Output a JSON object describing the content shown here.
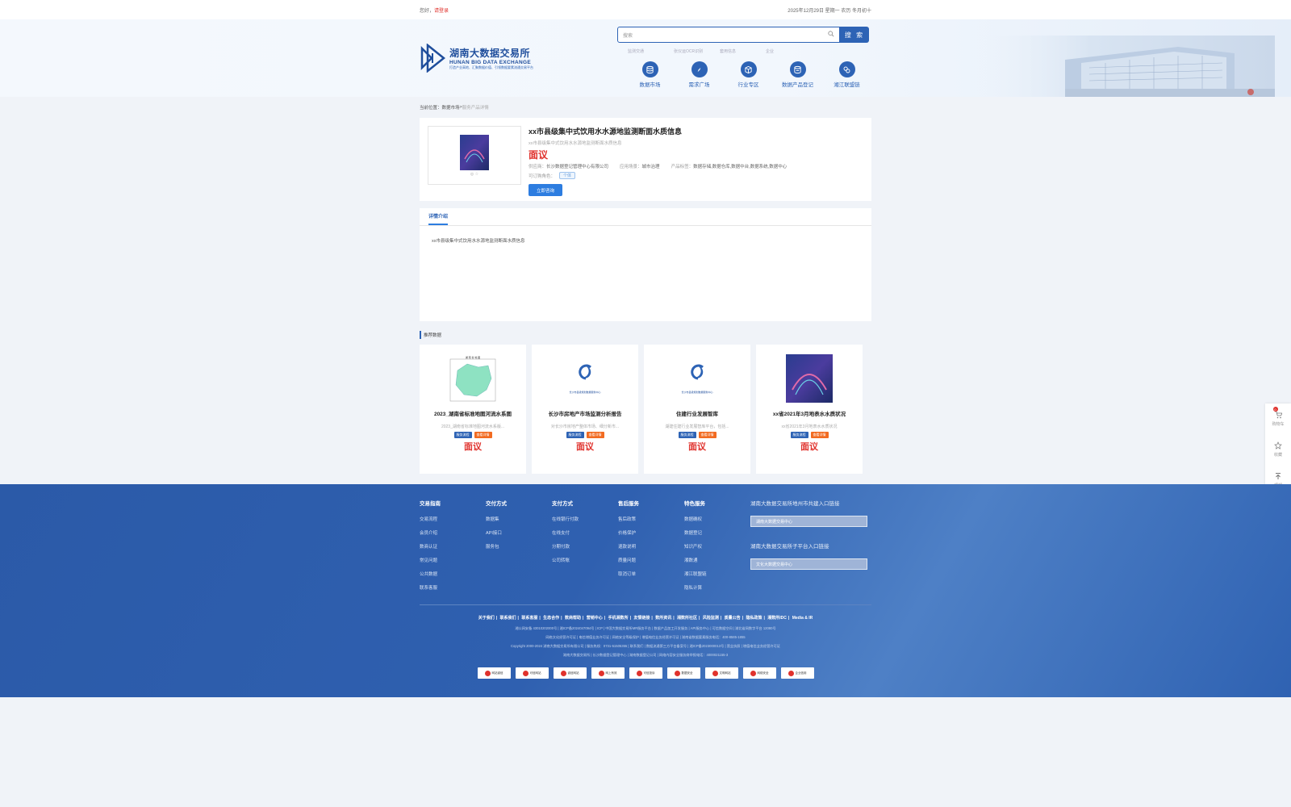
{
  "topbar": {
    "greeting": "您好，",
    "login": "请登录",
    "date": "2025年12月29日 星期一 农历 冬月初十"
  },
  "header": {
    "logo_cn": "湖南大数据交易所",
    "logo_en": "HUNAN BIG DATA EXCHANGE",
    "logo_slogan": "打造产业高地、汇聚数据价值、引领数据要素流通交易平台",
    "search_placeholder": "搜索",
    "search_button": "搜 索",
    "hotwords": [
      "监测交通",
      "张仪运OCR识别",
      "套用信息",
      "企业"
    ],
    "nav": [
      {
        "label": "数据市场",
        "icon": "database-icon"
      },
      {
        "label": "需求广场",
        "icon": "compass-icon"
      },
      {
        "label": "行业专区",
        "icon": "cube-icon"
      },
      {
        "label": "数据产品登记",
        "icon": "register-icon"
      },
      {
        "label": "湘江联盟链",
        "icon": "chain-icon"
      }
    ]
  },
  "breadcrumb": {
    "prefix": "当前位置：",
    "level1": "数据市场",
    "sep": " > ",
    "current": "服务产品详情"
  },
  "product": {
    "title": "xx市县级集中式饮用水水源地监测断面水质信息",
    "subtitle": "xx市县级集中式饮用水水源地监测断面水质信息",
    "price": "面议",
    "supplier_label": "供应商：",
    "supplier": "长沙数据登记管理中心有限公司",
    "scene_label": "应用场景：",
    "scene": "城市治理",
    "tags_label": "产品标签：",
    "tags": "数据存储,数据仓库,数据中台,数据系统,数据中心",
    "role_label": "可订购角色：",
    "role": "个体",
    "buy_button": "立即咨询",
    "image_icons": "◎ ☆"
  },
  "detail": {
    "tab": "详情介绍",
    "body": "xx市县级集中式饮用水水源地监测断面水质信息"
  },
  "recommend": {
    "heading": "推荐数据",
    "items": [
      {
        "title": "2023_湖南省标准地图河流水系图",
        "desc": "2023_湖南省标准地图河流水系版...",
        "tag1": "服务流程",
        "tag2": "查看详情",
        "price": "面议"
      },
      {
        "title": "长沙市房地产市场监测分析报告",
        "desc": "对长沙市房地产整体市场、细分新市...",
        "tag1": "服务流程",
        "tag2": "查看详情",
        "price": "面议"
      },
      {
        "title": "住建行业发展智库",
        "desc": "湖建住建行业发展智库平台，包括...",
        "tag1": "服务流程",
        "tag2": "查看详情",
        "price": "面议"
      },
      {
        "title": "xx省2021年3月地表水水质状况",
        "desc": "xx省2021年3月地表水水质状况",
        "tag1": "服务流程",
        "tag2": "查看详情",
        "price": "面议"
      }
    ]
  },
  "rightbar": {
    "cart": "购物车",
    "cart_count": "0",
    "favorite": "收藏",
    "top": "顶部"
  },
  "footer": {
    "cols": [
      {
        "title": "交易指南",
        "items": [
          "交易流程",
          "会员介绍",
          "数商认证",
          "常见问题",
          "公共数据",
          "联系客服"
        ]
      },
      {
        "title": "交付方式",
        "items": [
          "数据集",
          "API接口",
          "服务包"
        ]
      },
      {
        "title": "支付方式",
        "items": [
          "在线银行付款",
          "在线支付",
          "分期付款",
          "公司转账"
        ]
      },
      {
        "title": "售后服务",
        "items": [
          "售后政策",
          "价格保护",
          "退款说明",
          "质量问题",
          "取消订单"
        ]
      },
      {
        "title": "特色服务",
        "items": [
          "数据确权",
          "数据登记",
          "知识产权",
          "湘数通",
          "湘江联盟链",
          "隐私计算"
        ]
      }
    ],
    "sub1_title": "湖南大数据交易所地州市共建入口链接",
    "sub1_select": "湖南大数据交易中心",
    "sub2_title": "湖南大数据交易所子平台入口链接",
    "sub2_select": "文化大数据交易中心",
    "links": [
      "关于我们",
      "联系我们",
      "联系客服",
      "生态合作",
      "数商帮助",
      "营销中心",
      "手机湘数所",
      "友情链接",
      "数所资讯",
      "湘数所社区",
      "风险监测",
      "质量公告",
      "隐私政策",
      "湘数所IDC",
      "Media & IR"
    ],
    "info_lines": [
      "湘公网安备 43010202000号  |  湘ICP备2024047094号  |  ICP  |  中国大数据交易所MR服务平台  |  数据产品加工开发服务  |  API服务中心  |  可信数据空间  |  湖北省网数字平台 12080号",
      "网络文化经营许可证  |  电信增值业务许可证  |  网络安全等级保护  |  增值电信业务经营许可证  |  湖南省数据要素服务电话：400-8585-1855",
      "Copyright 2000-2024 湖南大数据交易所有限公司  |  服务热线：0731-51505355  |  联系我们  |  数据流通第三方平台备案号  |  湘ICP备2023000013号  |  营业执照  |  增值电信业务经营许可证",
      "湖南大数据交易所  |  长沙数据登记管理中心  |  湖南数据登记公司  |  网络内容安全服务商举报电话：4000021155-3"
    ],
    "badges": [
      "网站诚信",
      "可信网站",
      "诚信网站",
      "网上有效",
      "可信投诉",
      "数据安全",
      "文明网站",
      "网络安全",
      "企业信用"
    ]
  }
}
